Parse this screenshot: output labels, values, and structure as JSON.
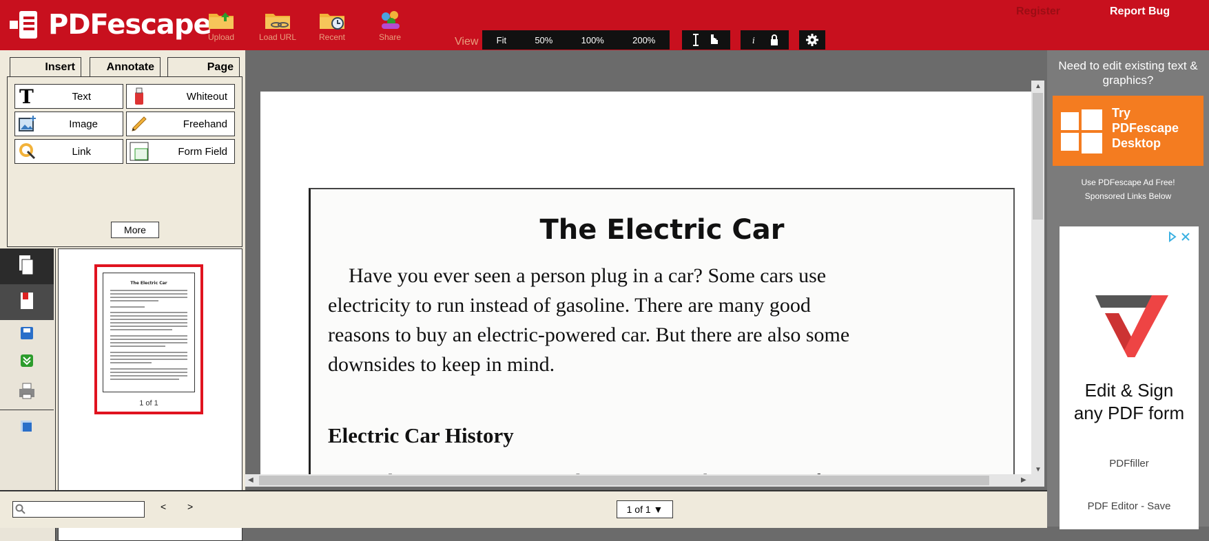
{
  "app": {
    "logo_text": "PDFescape",
    "brand_color": "#c8101e"
  },
  "toolbar": {
    "buttons": [
      {
        "label": "Upload",
        "icon": "folder-upload-icon"
      },
      {
        "label": "Load URL",
        "icon": "folder-link-icon"
      },
      {
        "label": "Recent",
        "icon": "folder-clock-icon"
      },
      {
        "label": "Share",
        "icon": "people-icon"
      }
    ],
    "view_label": "View",
    "zoom_options": [
      "Fit",
      "50%",
      "100%",
      "200%"
    ],
    "register": "Register",
    "report_bug": "Report Bug"
  },
  "left_panel": {
    "tabs": [
      "Insert",
      "Annotate",
      "Page"
    ],
    "tools": [
      {
        "label": "Text",
        "icon": "text-icon"
      },
      {
        "label": "Whiteout",
        "icon": "whiteout-icon"
      },
      {
        "label": "Image",
        "icon": "image-icon"
      },
      {
        "label": "Freehand",
        "icon": "pencil-icon"
      },
      {
        "label": "Link",
        "icon": "link-icon"
      },
      {
        "label": "Form Field",
        "icon": "form-field-icon"
      }
    ],
    "more": "More",
    "thumbnail_label": "1 of 1"
  },
  "document": {
    "title": "The Electric Car",
    "paragraph": [
      "Have you ever seen a person plug in a car? Some cars use",
      "electricity to run instead of gasoline. There are many good",
      "reasons to buy an electric-powered car. But there are also some",
      "downsides to keep in mind."
    ],
    "heading": "Electric Car History",
    "partial_line": "An electric car runs on an electric motor. The car uses a foot"
  },
  "bottom_bar": {
    "prev": "<",
    "next": ">",
    "page_indicator": "1 of 1 ▼"
  },
  "ad_panel": {
    "headline": "Need to edit existing text & graphics?",
    "try_text": "Try PDFescape Desktop",
    "ad_free": "Use PDFescape Ad Free!",
    "sponsored": "Sponsored Links Below",
    "card_headline": "Edit & Sign any PDF form",
    "card_brand": "PDFfiller",
    "card_bottom": "PDF Editor - Save"
  }
}
